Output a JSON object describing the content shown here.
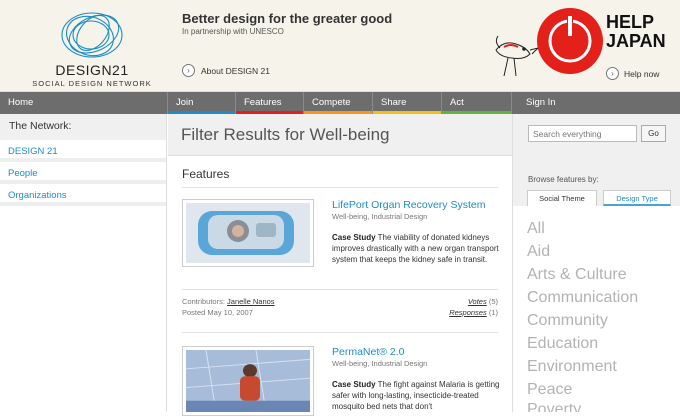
{
  "header": {
    "logo_name": "DESIGN21",
    "logo_subtitle": "SOCIAL DESIGN NETWORK",
    "tagline": "Better design for the greater good",
    "partner": "In partnership with UNESCO",
    "about_link": "About DESIGN 21",
    "help_japan": "HELP JAPAN",
    "help_now": "Help now"
  },
  "nav": [
    {
      "label": "Home",
      "accent": ""
    },
    {
      "label": "Join",
      "accent": "#1e8cc6"
    },
    {
      "label": "Features",
      "accent": "#e32019"
    },
    {
      "label": "Compete",
      "accent": "#f39a1c"
    },
    {
      "label": "Share",
      "accent": "#f2c01a"
    },
    {
      "label": "Act",
      "accent": "#63b33c"
    },
    {
      "label": "Sign In",
      "accent": ""
    }
  ],
  "network": {
    "title": "The Network:",
    "items": [
      "DESIGN 21",
      "People",
      "Organizations"
    ]
  },
  "main": {
    "page_title": "Filter Results for Well-being",
    "section": "Features",
    "features": [
      {
        "title": "LifePort Organ Recovery System",
        "category": "Well-being, Industrial Design",
        "type": "Case Study",
        "description": "The viability of donated kidneys improves drastically with a new organ transport system that keeps the kidney safe in transit.",
        "contributors_label": "Contributors:",
        "contributor": "Janelle Nanos",
        "posted": "Posted May 10, 2007",
        "votes_label": "Votes",
        "votes": "(5)",
        "responses_label": "Responses",
        "responses": "(1)"
      },
      {
        "title": "PermaNet® 2.0",
        "category": "Well-being, Industrial Design",
        "type": "Case Study",
        "description": "The fight against Malaria is getting safer with long-lasting, insecticide-treated mosquito bed nets that don't"
      }
    ]
  },
  "sidebar": {
    "search_placeholder": "Search everything",
    "go_label": "Go",
    "browse_label": "Browse features by:",
    "tabs": [
      "Social Theme",
      "Design Type"
    ],
    "themes": [
      "All",
      "Aid",
      "Arts & Culture",
      "Communication",
      "Community",
      "Education",
      "Environment",
      "Peace",
      "Poverty"
    ]
  },
  "colors": {
    "link_blue": "#1e8cc6",
    "japan_red": "#e32019",
    "nav_gray": "#6d6d6d"
  }
}
